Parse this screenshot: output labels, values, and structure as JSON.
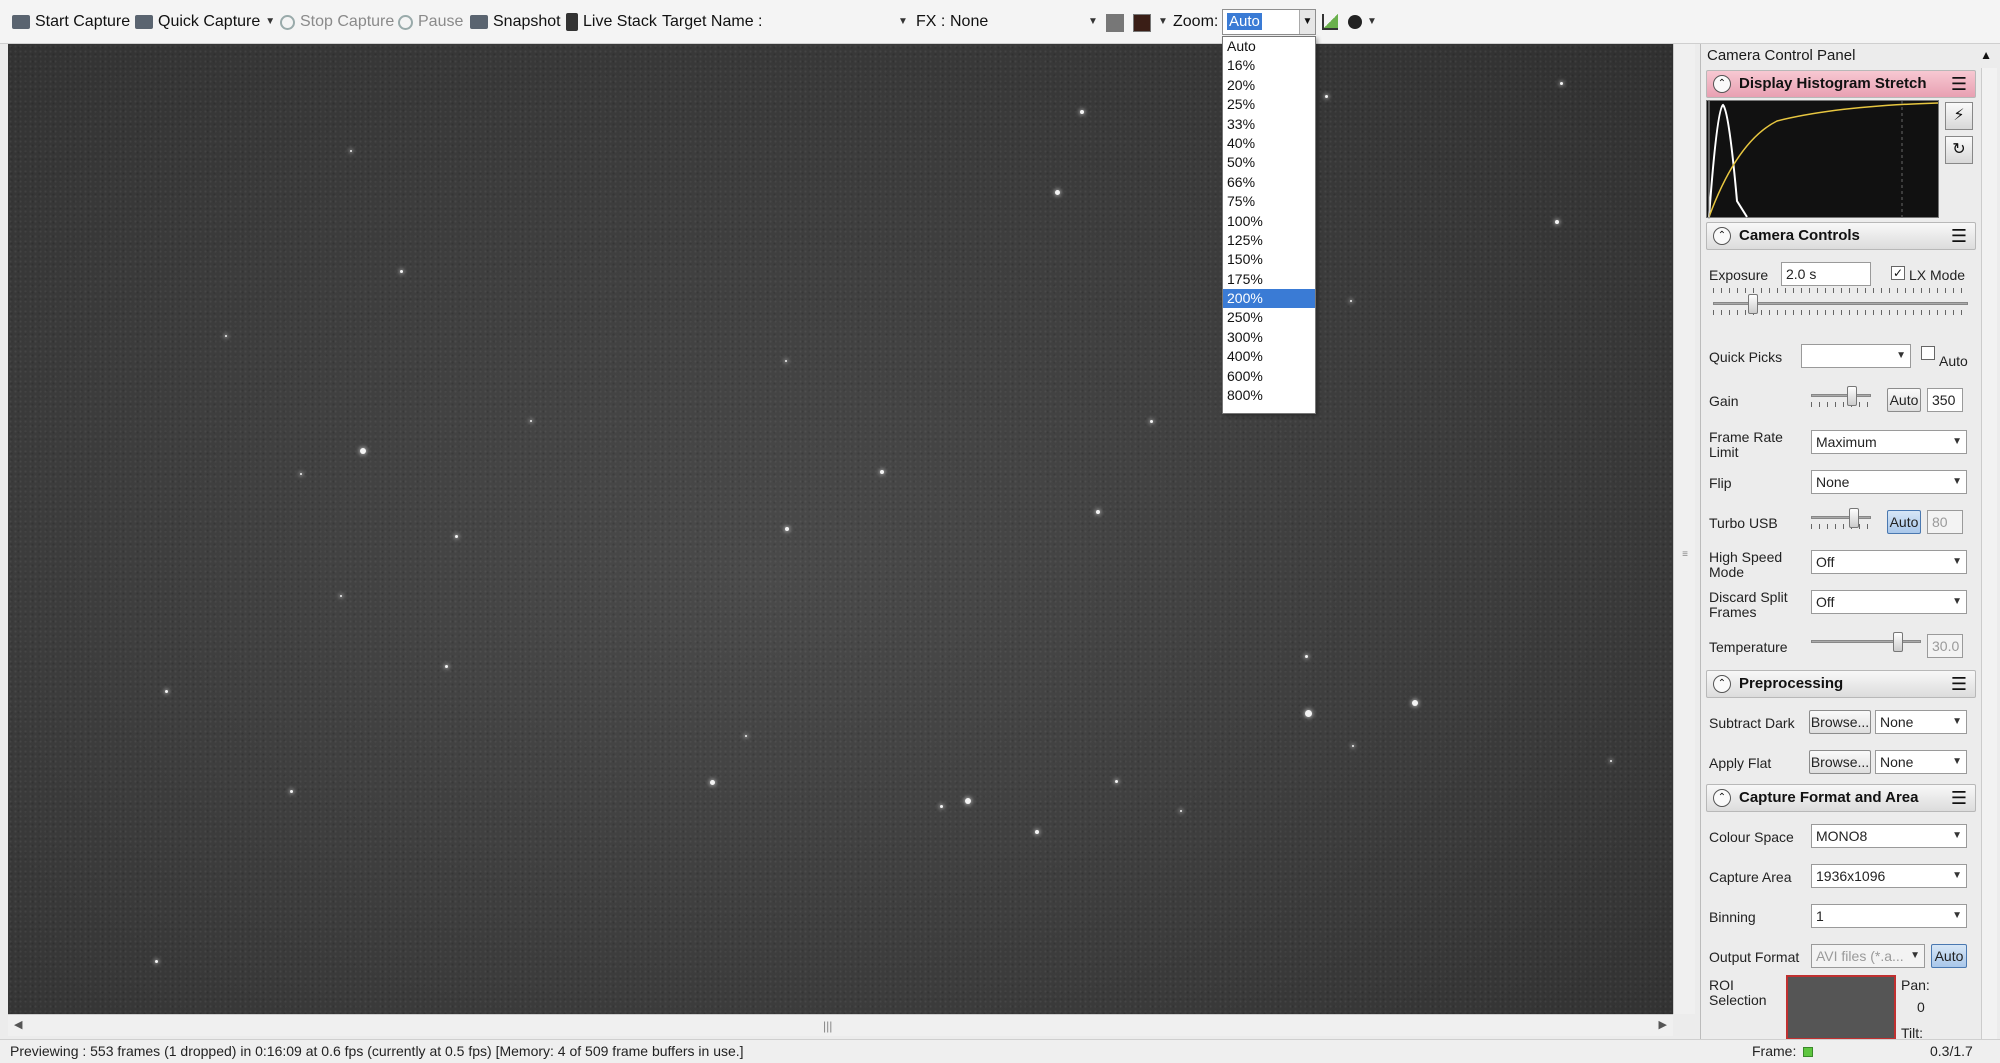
{
  "toolbar": {
    "start_capture": "Start Capture",
    "quick_capture": "Quick Capture",
    "stop_capture": "Stop Capture",
    "pause": "Pause",
    "snapshot": "Snapshot",
    "live_stack": "Live Stack",
    "target_name_label": "Target Name :",
    "fx_label": "FX :",
    "fx_value": "None",
    "zoom_label": "Zoom:",
    "zoom_value": "Auto"
  },
  "zoom_options": [
    "Auto",
    "16%",
    "20%",
    "25%",
    "33%",
    "40%",
    "50%",
    "66%",
    "75%",
    "100%",
    "125%",
    "150%",
    "175%",
    "200%",
    "250%",
    "300%",
    "400%",
    "600%",
    "800%"
  ],
  "zoom_highlighted": "200%",
  "panel": {
    "title": "Camera Control Panel",
    "histogram_section": "Display Histogram Stretch",
    "camera_section": "Camera Controls",
    "exposure_label": "Exposure",
    "exposure_value": "2.0 s",
    "lx_mode_label": "LX Mode",
    "quick_picks_label": "Quick Picks",
    "auto_label": "Auto",
    "gain_label": "Gain",
    "gain_auto": "Auto",
    "gain_value": "350",
    "frame_rate_label": "Frame Rate Limit",
    "frame_rate_value": "Maximum",
    "flip_label": "Flip",
    "flip_value": "None",
    "turbo_label": "Turbo USB",
    "turbo_auto": "Auto",
    "turbo_value": "80",
    "high_speed_label": "High Speed Mode",
    "high_speed_value": "Off",
    "discard_label": "Discard Split Frames",
    "discard_value": "Off",
    "temperature_label": "Temperature",
    "temperature_value": "30.0",
    "preprocessing_section": "Preprocessing",
    "subtract_dark_label": "Subtract Dark",
    "browse": "Browse...",
    "subtract_dark_value": "None",
    "apply_flat_label": "Apply Flat",
    "apply_flat_value": "None",
    "capture_section": "Capture Format and Area",
    "colour_space_label": "Colour Space",
    "colour_space_value": "MONO8",
    "capture_area_label": "Capture Area",
    "capture_area_value": "1936x1096",
    "binning_label": "Binning",
    "binning_value": "1",
    "output_format_label": "Output Format",
    "output_format_value": "AVI files (*.a...",
    "output_auto": "Auto",
    "roi_label": "ROI Selection",
    "pan_label": "Pan:",
    "pan_value": "0",
    "tilt_label": "Tilt:"
  },
  "status": {
    "text": "Previewing : 553 frames (1 dropped) in 0:16:09 at 0.6 fps  (currently at 0.5 fps) [Memory: 4 of 509 frame buffers in use.]",
    "frame_label": "Frame:",
    "frame_value": "0.3/1.7"
  },
  "colors": {
    "selection": "#3a7bd5",
    "histogram_header": "#e8a0b2",
    "sky": "#3c3c3c"
  }
}
